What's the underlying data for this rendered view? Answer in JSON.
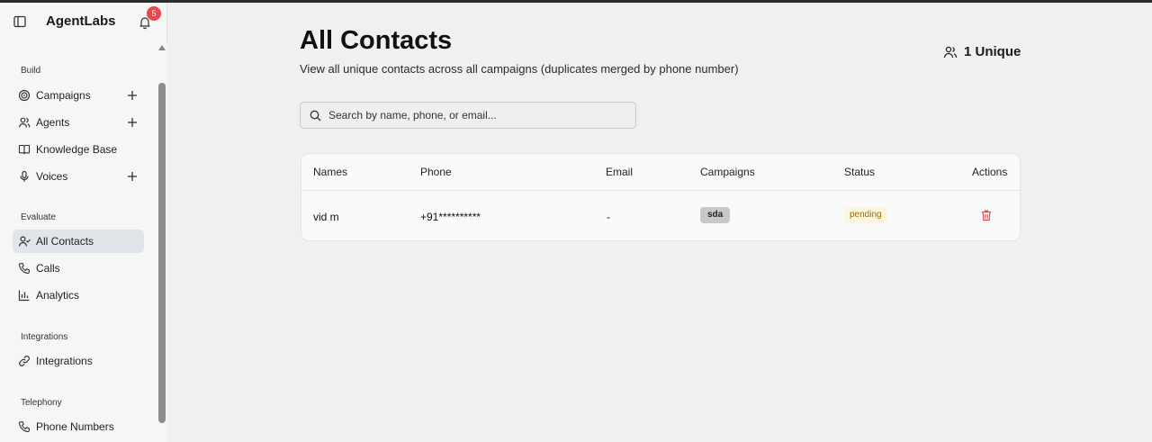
{
  "app": {
    "brand": "AgentLabs",
    "notifications_count": "5"
  },
  "sidebar": {
    "groups": [
      {
        "label": "Build",
        "items": [
          {
            "label": "Campaigns",
            "icon": "target-icon",
            "has_add": true
          },
          {
            "label": "Agents",
            "icon": "users-icon",
            "has_add": true
          },
          {
            "label": "Knowledge Base",
            "icon": "book-icon",
            "has_add": false
          },
          {
            "label": "Voices",
            "icon": "mic-icon",
            "has_add": true
          }
        ]
      },
      {
        "label": "Evaluate",
        "items": [
          {
            "label": "All Contacts",
            "icon": "user-check-icon",
            "active": true
          },
          {
            "label": "Calls",
            "icon": "phone-icon"
          },
          {
            "label": "Analytics",
            "icon": "bar-chart-icon"
          }
        ]
      },
      {
        "label": "Integrations",
        "items": [
          {
            "label": "Integrations",
            "icon": "link-icon"
          }
        ]
      },
      {
        "label": "Telephony",
        "items": [
          {
            "label": "Phone Numbers",
            "icon": "phone-icon"
          }
        ]
      }
    ]
  },
  "main": {
    "title": "All Contacts",
    "subtitle": "View all unique contacts across all campaigns (duplicates merged by phone number)",
    "unique_count": "1 Unique",
    "search": {
      "placeholder": "Search by name, phone, or email...",
      "value": ""
    },
    "table": {
      "columns": [
        "Names",
        "Phone",
        "Email",
        "Campaigns",
        "Status",
        "Actions"
      ],
      "rows": [
        {
          "name": "vid m",
          "phone": "+91**********",
          "email": "-",
          "campaign": "sda",
          "status": "pending"
        }
      ]
    }
  },
  "colors": {
    "accent_badge": "#e5484d",
    "active_nav": "#e1e5ea",
    "status_pending_bg": "#fdf6de",
    "status_pending_text": "#9a6a00",
    "delete_icon": "#e5484d"
  }
}
